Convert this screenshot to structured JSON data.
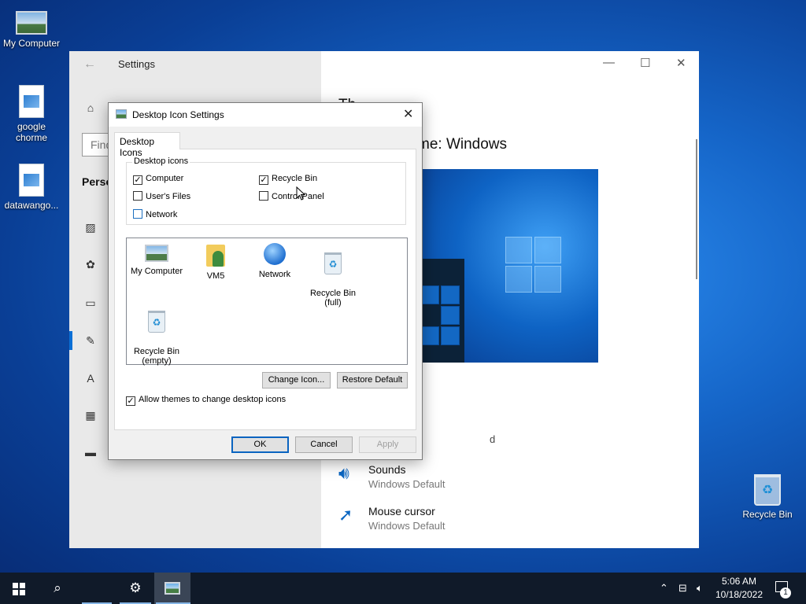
{
  "desktop": {
    "icons": [
      {
        "label": "My Computer",
        "icon": "computer-icon"
      },
      {
        "label": "google chorme",
        "icon": "image-file-icon"
      },
      {
        "label": "datawango...",
        "icon": "image-file-icon"
      },
      {
        "label": "Recycle Bin",
        "icon": "recycle-bin-icon"
      }
    ]
  },
  "settings": {
    "title": "Settings",
    "search_placeholder": "Find",
    "personalization_label": "Perso",
    "theme_heading": "me: Windows",
    "theme_partial_top": "Th",
    "partial_d": "d",
    "items": [
      {
        "name": "Sounds",
        "value": "Windows Default",
        "icon": "speaker-icon"
      },
      {
        "name": "Mouse cursor",
        "value": "Windows Default",
        "icon": "pointer-icon"
      }
    ],
    "sidebar_icons": [
      "home-icon",
      "image-icon",
      "palette-icon",
      "lock-screen-icon",
      "themes-icon",
      "font-icon",
      "start-icon",
      "taskbar-icon"
    ]
  },
  "dialog": {
    "title": "Desktop Icon Settings",
    "tab_label": "Desktop Icons",
    "group_label": "Desktop icons",
    "checkboxes": [
      {
        "label": "Computer",
        "checked": true
      },
      {
        "label": "Recycle Bin",
        "checked": true
      },
      {
        "label": "User's Files",
        "checked": false
      },
      {
        "label": "Control Panel",
        "checked": false
      },
      {
        "label": "Network",
        "checked": false
      }
    ],
    "icon_list": [
      {
        "label": "My Computer",
        "icon": "computer-icon"
      },
      {
        "label": "VM5",
        "icon": "user-folder-icon"
      },
      {
        "label": "Network",
        "icon": "network-icon"
      },
      {
        "label": "Recycle Bin\n(full)",
        "icon": "recycle-bin-full-icon"
      },
      {
        "label": "Recycle Bin\n(empty)",
        "icon": "recycle-bin-empty-icon"
      }
    ],
    "change_icon_label": "Change Icon...",
    "restore_default_label": "Restore Default",
    "allow_themes_label": "Allow themes to change desktop icons",
    "allow_themes_checked": true,
    "ok_label": "OK",
    "cancel_label": "Cancel",
    "apply_label": "Apply"
  },
  "taskbar": {
    "time": "5:06 AM",
    "date": "10/18/2022",
    "notification_count": "1"
  }
}
